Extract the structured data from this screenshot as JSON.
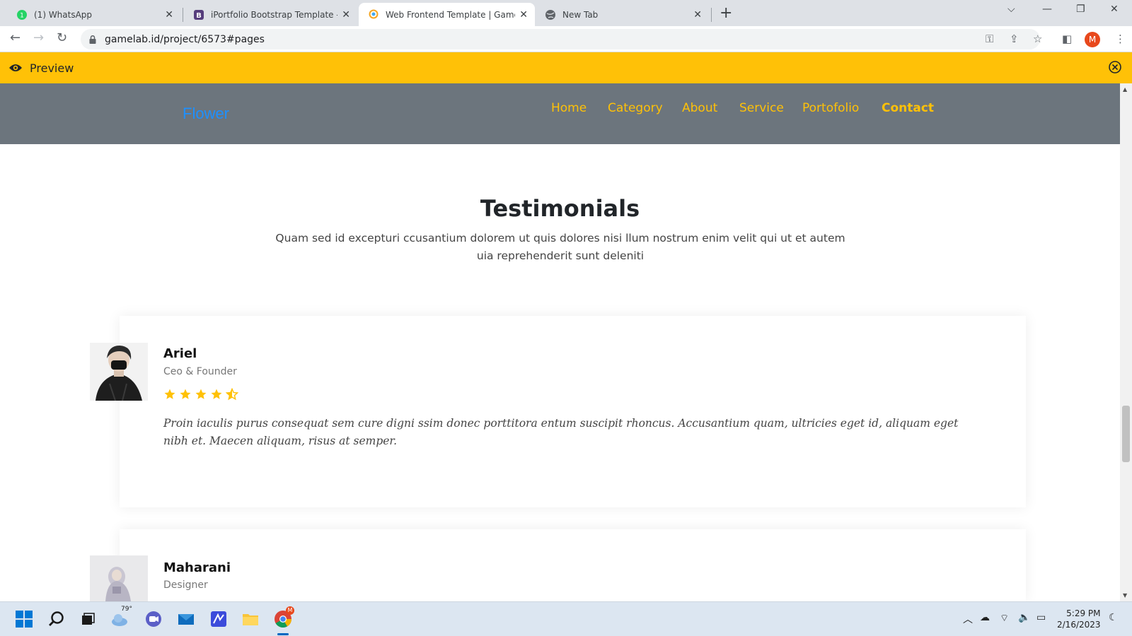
{
  "browser": {
    "tabs": [
      {
        "title": "(1) WhatsApp",
        "icon": "whatsapp-icon"
      },
      {
        "title": "iPortfolio Bootstrap Template - In",
        "icon": "bootstrap-icon"
      },
      {
        "title": "Web Frontend Template | Gamela",
        "icon": "gamelab-icon",
        "active": true
      },
      {
        "title": "New Tab",
        "icon": "globe-icon"
      }
    ],
    "url": "gamelab.id/project/6573#pages",
    "profile_initial": "M"
  },
  "preview_bar": {
    "label": "Preview",
    "color": "#ffc107"
  },
  "site": {
    "brand": "Flower",
    "nav": [
      "Home",
      "Category",
      "About",
      "Service",
      "Portofolio",
      "Contact"
    ],
    "active_nav": "Contact"
  },
  "testimonials": {
    "title": "Testimonials",
    "subtitle": "Quam sed id excepturi ccusantium dolorem ut quis dolores nisi llum nostrum enim velit qui ut et autem uia reprehenderit sunt deleniti",
    "items": [
      {
        "name": "Ariel",
        "role": "Ceo & Founder",
        "rating": 4.5,
        "quote": " Proin iaculis purus consequat sem cure digni ssim donec porttitora entum suscipit rhoncus. Accusantium quam, ultricies eget id, aliquam eget nibh et. Maecen aliquam, risus at semper."
      },
      {
        "name": "Maharani",
        "role": "Designer"
      }
    ]
  },
  "taskbar": {
    "weather": "79°",
    "time": "5:29 PM",
    "date": "2/16/2023"
  }
}
